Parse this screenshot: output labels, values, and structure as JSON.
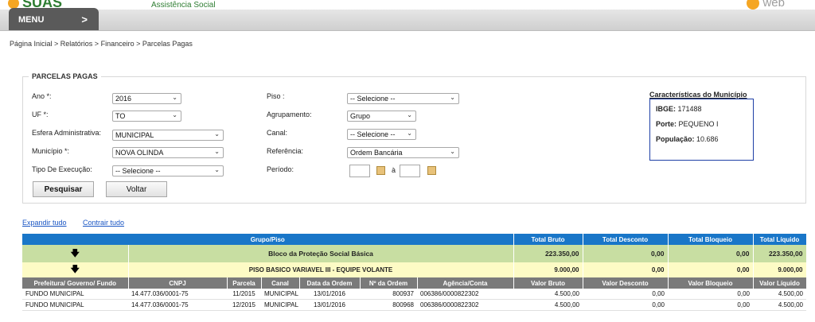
{
  "brand": {
    "name": "SUAS",
    "subtitle": "Assistência Social",
    "web": "web"
  },
  "menu": {
    "label": "MENU",
    "chevron": ">"
  },
  "breadcrumb": "Página Inicial > Relatórios > Financeiro > Parcelas Pagas",
  "panel": {
    "legend": "PARCELAS PAGAS",
    "fields": {
      "ano": {
        "label": "Ano *:",
        "value": "2016"
      },
      "uf": {
        "label": "UF *:",
        "value": "TO"
      },
      "esfera": {
        "label": "Esfera Administrativa:",
        "value": "MUNICIPAL"
      },
      "municipio": {
        "label": "Município *:",
        "value": "NOVA OLINDA"
      },
      "tipo": {
        "label": "Tipo De Execução:",
        "value": "-- Selecione --"
      },
      "piso": {
        "label": "Piso :",
        "value": "-- Selecione --"
      },
      "agrupamento": {
        "label": "Agrupamento:",
        "value": "Grupo"
      },
      "canal": {
        "label": "Canal:",
        "value": "-- Selecione --"
      },
      "referencia": {
        "label": "Referência:",
        "value": "Ordem Bancária"
      },
      "periodo": {
        "label": "Período:",
        "separator": "à"
      }
    },
    "buttons": {
      "pesquisar": "Pesquisar",
      "voltar": "Voltar"
    }
  },
  "municipio_info": {
    "title": "Características do Município",
    "ibge_label": "IBGE:",
    "ibge": "171488",
    "porte_label": "Porte:",
    "porte": "PEQUENO I",
    "populacao_label": "População:",
    "populacao": "10.686"
  },
  "links": {
    "expandir": "Expandir tudo",
    "contrair": "Contrair tudo"
  },
  "table": {
    "header": [
      "Grupo/Piso",
      "Total Bruto",
      "Total Desconto",
      "Total Bloqueio",
      "Total Líquido"
    ],
    "bloco": {
      "name": "Bloco da Proteção Social Básica",
      "bruto": "223.350,00",
      "desconto": "0,00",
      "bloqueio": "0,00",
      "liquido": "223.350,00"
    },
    "piso": {
      "name": "PISO BASICO VARIAVEL III - EQUIPE VOLANTE",
      "bruto": "9.000,00",
      "desconto": "0,00",
      "bloqueio": "0,00",
      "liquido": "9.000,00"
    },
    "detail_header": [
      "Prefeitura/ Governo/ Fundo",
      "CNPJ",
      "Parcela",
      "Canal",
      "Data da Ordem",
      "Nº da Ordem",
      "Agência/Conta",
      "Valor Bruto",
      "Valor Desconto",
      "Valor Bloqueio",
      "Valor Líquido"
    ],
    "rows": [
      [
        "FUNDO MUNICIPAL",
        "14.477.036/0001-75",
        "11/2015",
        "MUNICIPAL",
        "13/01/2016",
        "800937",
        "006386/0000822302",
        "4.500,00",
        "0,00",
        "0,00",
        "4.500,00"
      ],
      [
        "FUNDO MUNICIPAL",
        "14.477.036/0001-75",
        "12/2015",
        "MUNICIPAL",
        "13/01/2016",
        "800968",
        "006386/0000822302",
        "4.500,00",
        "0,00",
        "0,00",
        "4.500,00"
      ]
    ]
  }
}
